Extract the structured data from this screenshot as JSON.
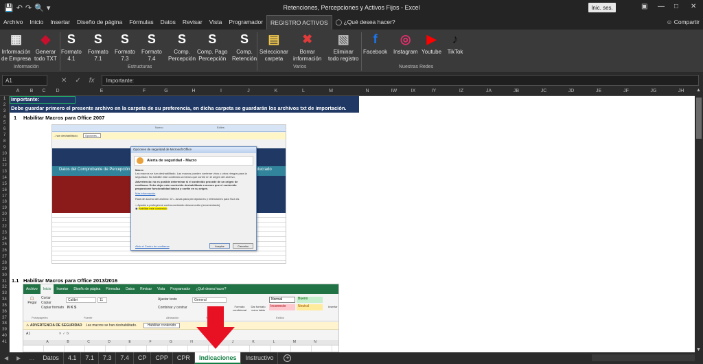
{
  "window": {
    "title": "Retenciones, Percepciones y Activos Fijos  -  Excel",
    "signin": "Inic. ses."
  },
  "menu": {
    "items": [
      "Archivo",
      "Inicio",
      "Insertar",
      "Diseño de página",
      "Fórmulas",
      "Datos",
      "Revisar",
      "Vista",
      "Programador",
      "REGISTRO ACTIVOS"
    ],
    "tellme": "¿Qué desea hacer?",
    "share": "Compartir"
  },
  "ribbon": {
    "buttons": [
      {
        "label1": "Información",
        "label2": "de Empresa",
        "icon": "building-icon",
        "color": "#e8e8e8"
      },
      {
        "label1": "Generar",
        "label2": "todo TXT",
        "icon": "sunat-logo-icon",
        "color": "#c8102e"
      },
      {
        "label1": "Formato",
        "label2": "4.1",
        "icon": "s-logo-icon",
        "color": "#ffffff"
      },
      {
        "label1": "Formato",
        "label2": "7.1",
        "icon": "s-logo-icon",
        "color": "#ffffff"
      },
      {
        "label1": "Formato",
        "label2": "7.3",
        "icon": "s-logo-icon",
        "color": "#ffffff"
      },
      {
        "label1": "Formato",
        "label2": "7.4",
        "icon": "s-logo-icon",
        "color": "#ffffff"
      },
      {
        "label1": "Comp.",
        "label2": "Percepción",
        "icon": "s-logo-icon",
        "color": "#ffffff"
      },
      {
        "label1": "Comp. Pago",
        "label2": "Percepción",
        "icon": "s-logo-icon",
        "color": "#ffffff"
      },
      {
        "label1": "Comp.",
        "label2": "Retención",
        "icon": "s-logo-icon",
        "color": "#ffffff"
      },
      {
        "label1": "Seleccionar",
        "label2": "carpeta",
        "icon": "folder-icon",
        "color": "#f2c94c"
      },
      {
        "label1": "Borrar",
        "label2": "información",
        "icon": "trash-icon",
        "color": "#e03a3a"
      },
      {
        "label1": "Eliminar",
        "label2": "todo registro",
        "icon": "erase-icon",
        "color": "#bdbdbd"
      },
      {
        "label1": "Facebook",
        "label2": "",
        "icon": "facebook-icon",
        "color": "#1877f2"
      },
      {
        "label1": "Instagram",
        "label2": "",
        "icon": "instagram-icon",
        "color": "#e1306c"
      },
      {
        "label1": "Youtube",
        "label2": "",
        "icon": "youtube-icon",
        "color": "#ff0000"
      },
      {
        "label1": "TikTok",
        "label2": "",
        "icon": "tiktok-icon",
        "color": "#111111"
      }
    ],
    "groups": [
      "Información",
      "Estructuras",
      "Varios",
      "Nuestras Redes"
    ]
  },
  "formula_bar": {
    "namebox": "A1",
    "content": "Importante:"
  },
  "columns": [
    "A",
    "B",
    "C",
    "D",
    "E",
    "F",
    "G",
    "H",
    "I",
    "J",
    "K",
    "L",
    "M",
    "N",
    "IW",
    "IX",
    "IY",
    "IZ",
    "JA",
    "JB",
    "JC",
    "JD",
    "JE",
    "JF",
    "JG",
    "JH"
  ],
  "rows": [
    "1",
    "2",
    "3",
    "4",
    "5",
    "6",
    "7",
    "8",
    "9",
    "10",
    "11",
    "12",
    "13",
    "14",
    "15",
    "16",
    "17",
    "18",
    "19",
    "20",
    "21",
    "22",
    "23",
    "24",
    "25",
    "26",
    "27",
    "28",
    "29",
    "30",
    "31",
    "32",
    "33",
    "34",
    "35",
    "36",
    "37",
    "38",
    "39",
    "40",
    "41"
  ],
  "sheet": {
    "banner_title": "Importante:",
    "banner_text": "Debe guardar primero el presente archivo en la carpeta de su preferencia, en dicha carpeta se guardarán los archivos txt de importación.",
    "section1_num": "1",
    "section1_title": "Habilitar Macros  para Office 2007",
    "section2_num": "1.1",
    "section2_title": "Habilitar Macros  para Office 2013/2016"
  },
  "shot2007": {
    "bar_items": [
      "Nuevo",
      "Ediles"
    ],
    "warning": "...han deshabilitado.",
    "options_btn": "Opciones...",
    "header_text": "Datos del Comprobante de Percepción",
    "header_right": "...involucrado",
    "dialog_title": "Opciones de seguridad de Microsoft Office",
    "dialog_heading": "Alerta de seguridad - Macro",
    "dialog_section": "Macro",
    "dialog_text": "Las macros se han deshabilitado. Las macros pueden contener virus u otros riesgos para la seguridad. No habilite este contenido a menos que confíe en el origen del archivo.",
    "dialog_warn": "Advertencia: no es posible determinar si el contenido procede de un origen de confianza. Debe dejar este contenido deshabilitado a menos que el contenido proporcione funcionalidad básica y confíe en su origen.",
    "dialog_link": "Más información",
    "dialog_path": "Ruta de acceso del archivo:   D:\\...tunas para percepciones y retenciones para SUJ.xls",
    "opt1": "Ayudar a protegerme contra contenido desconocido (recomendado)",
    "opt2": "Habilitar este contenido",
    "trust_link": "Abrir el Centro de confianza",
    "accept": "Aceptar",
    "cancel": "Cancelar"
  },
  "shot2016": {
    "tabs": [
      "Archivo",
      "Inicio",
      "Insertar",
      "Diseño de página",
      "Fórmulas",
      "Datos",
      "Revisar",
      "Vista",
      "Programador",
      "¿Qué desea hacer?"
    ],
    "clip_items": [
      "Cortar",
      "Copiar",
      "Copiar formato"
    ],
    "font": "Calibri",
    "size": "11",
    "wrap": "Ajustar texto",
    "merge": "Combinar y centrar",
    "numfmt": "General",
    "styles": [
      "Normal",
      "Bueno",
      "Incorrecto",
      "Neutral"
    ],
    "groups": [
      "Portapapeles",
      "Fuente",
      "Alineación",
      "Número",
      "Estilos"
    ],
    "cf": "Formato condicional",
    "ft": "Dar formato como tabla",
    "insert": "Insertar",
    "paste": "Pegar",
    "warning_label": "ADVERTENCIA DE SEGURIDAD",
    "warning_text": "Las macros se han deshabilitado.",
    "enable_btn": "Habilitar contenido",
    "namebox": "A1",
    "cols": [
      "A",
      "B",
      "C",
      "D",
      "E",
      "F",
      "G",
      "H",
      "I",
      "J",
      "K",
      "L",
      "M",
      "N"
    ]
  },
  "tabs": {
    "items": [
      "Datos",
      "4.1",
      "7.1",
      "7.3",
      "7.4",
      "CP",
      "CPP",
      "CPR",
      "Indicaciones",
      "Instructivo"
    ],
    "active": "Indicaciones"
  },
  "colors": {
    "excel_green": "#107c41",
    "banner": "#1f3864",
    "arrow": "#e81123"
  }
}
